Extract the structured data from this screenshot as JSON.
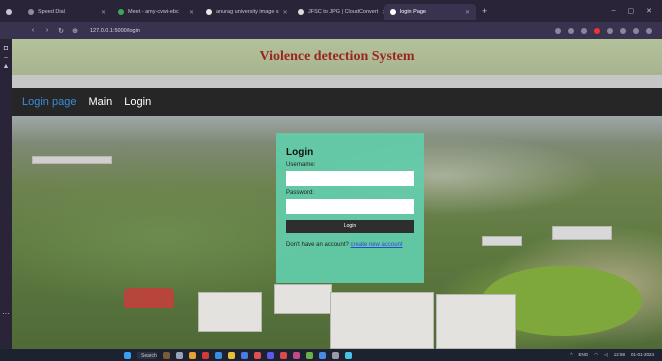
{
  "browser": {
    "tabs": [
      {
        "label": "Speed Dial",
        "active": false
      },
      {
        "label": "Meet - amy-cvwi-ebc",
        "active": false
      },
      {
        "label": "anurag university image s",
        "active": false
      },
      {
        "label": "JFSC to JPG | CloudConvert",
        "active": false
      },
      {
        "label": "login Page",
        "active": true
      }
    ],
    "new_tab": "+",
    "url": "127.0.0.1:5000/login",
    "window_controls": [
      "–",
      "▢",
      "✕"
    ]
  },
  "page": {
    "title": "Violence detection System",
    "nav": [
      {
        "label": "Login page",
        "current": true
      },
      {
        "label": "Main",
        "current": false
      },
      {
        "label": "Login",
        "current": false
      }
    ],
    "login": {
      "heading": "Login",
      "username_label": "Username:",
      "username_value": "",
      "password_label": "Password:",
      "password_value": "",
      "button": "Login",
      "footer_text": "Don't have an account? ",
      "footer_link": "create new account"
    }
  },
  "taskbar": {
    "search_placeholder": "Search",
    "lang": "ENG",
    "time": "12:58",
    "date": "01-01-2024"
  },
  "colors": {
    "title": "#9b2520",
    "header_bg": "#b4c29c",
    "nav_bg": "#262626",
    "nav_current": "#3b8cdc",
    "card_bg": "#62cdaa",
    "button_bg": "#2e2e2e",
    "link": "#2a4bd7"
  }
}
